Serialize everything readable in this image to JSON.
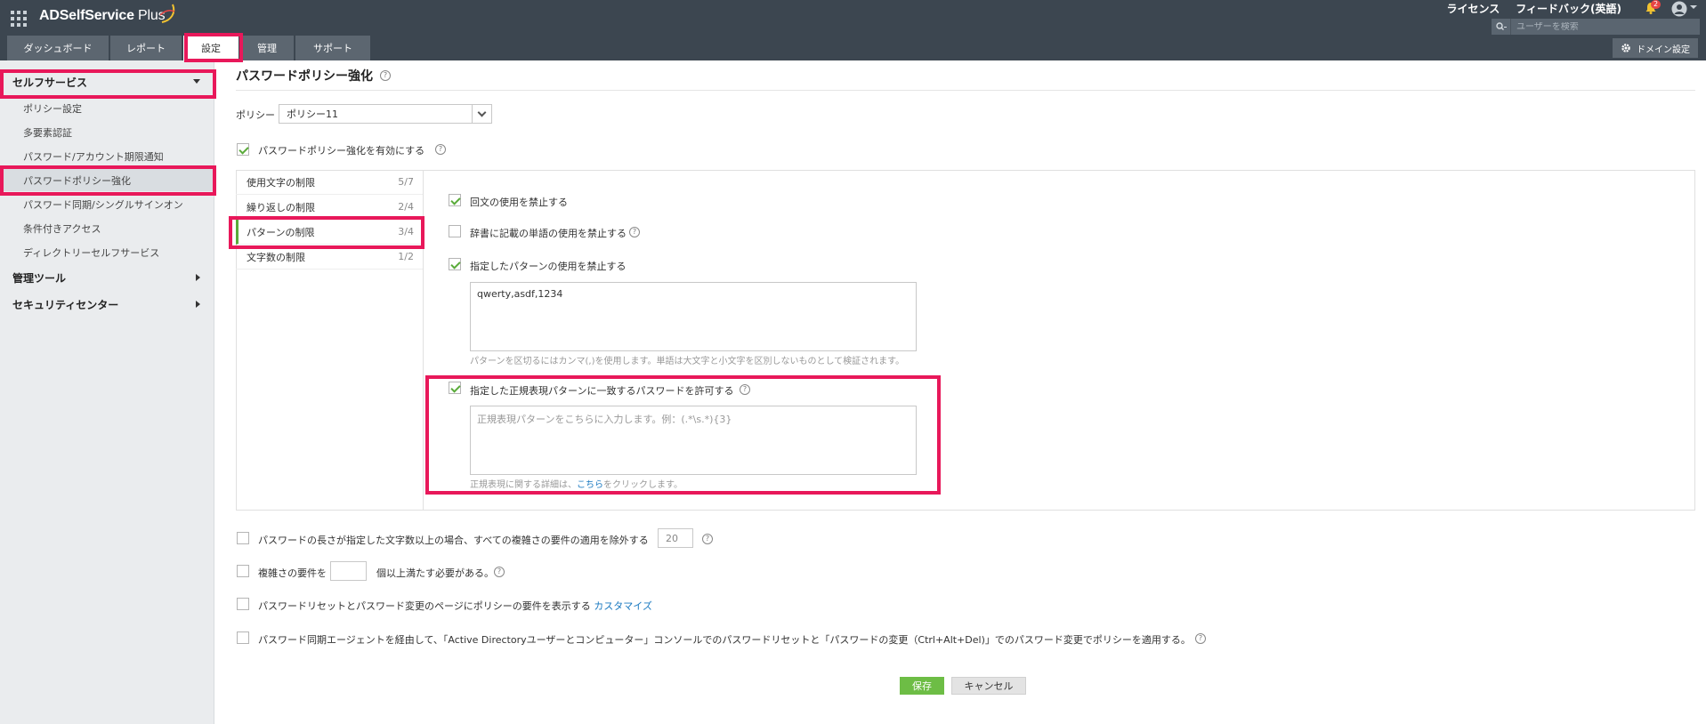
{
  "app": {
    "title": "ADSelfService Plus",
    "title_main": "ADSelfService",
    "title_plus": " Plus"
  },
  "top_links": {
    "license": "ライセンス",
    "feedback": "フィードバック(英語)"
  },
  "notifications": {
    "count": "2"
  },
  "search": {
    "placeholder": "ユーザーを検索"
  },
  "tabs": [
    {
      "label": "ダッシュボード"
    },
    {
      "label": "レポート"
    },
    {
      "label": "設定",
      "active": true
    },
    {
      "label": "管理"
    },
    {
      "label": "サポート"
    }
  ],
  "domain_settings": "ドメイン設定",
  "sidebar": {
    "self_service": "セルフサービス",
    "items": [
      {
        "label": "ポリシー設定"
      },
      {
        "label": "多要素認証"
      },
      {
        "label": "パスワード/アカウント期限通知"
      },
      {
        "label": "パスワードポリシー強化",
        "active": true
      },
      {
        "label": "パスワード同期/シングルサインオン"
      },
      {
        "label": "条件付きアクセス"
      },
      {
        "label": "ディレクトリーセルフサービス"
      }
    ],
    "admin_tools": "管理ツール",
    "security_center": "セキュリティセンター"
  },
  "page": {
    "title": "パスワードポリシー強化",
    "policy_label": "ポリシー",
    "policy_value": "ポリシー11",
    "enable_label": "パスワードポリシー強化を有効にする"
  },
  "rule_nav": [
    {
      "label": "使用文字の制限",
      "count": "5/7"
    },
    {
      "label": "繰り返しの制限",
      "count": "2/4"
    },
    {
      "label": "パターンの制限",
      "count": "3/4",
      "active": true
    },
    {
      "label": "文字数の制限",
      "count": "1/2"
    }
  ],
  "pattern_rules": {
    "palindrome": "回文の使用を禁止する",
    "dictionary": "辞書に記載の単語の使用を禁止する",
    "specified_pattern": "指定したパターンの使用を禁止する",
    "pattern_value": "qwerty,asdf,1234",
    "pattern_hint": "パターンを区切るにはカンマ(,)を使用します。単語は大文字と小文字を区別しないものとして検証されます。",
    "regex_allow": "指定した正規表現パターンに一致するパスワードを許可する",
    "regex_placeholder": "正規表現パターンをこちらに入力します。例：(.*\\s.*){3}",
    "regex_hint_prefix": "正規表現に関する詳細は、",
    "regex_hint_link": "こちら",
    "regex_hint_suffix": "をクリックします。"
  },
  "options": {
    "length_exempt": "パスワードの長さが指定した文字数以上の場合、すべての複雑さの要件の適用を除外する",
    "length_value": "20",
    "complexity_prefix": "複雑さの要件を",
    "complexity_suffix": "個以上満たす必要がある。",
    "show_policy": "パスワードリセットとパスワード変更のページにポリシーの要件を表示する",
    "customize": "カスタマイズ",
    "sync_agent": "パスワード同期エージェントを経由して、「Active Directoryユーザーとコンピューター」コンソールでのパスワードリセットと「パスワードの変更（Ctrl+Alt+Del)」でのパスワード変更でポリシーを適用する。"
  },
  "buttons": {
    "save": "保存",
    "cancel": "キャンセル"
  },
  "colors": {
    "topbar": "#3c4650",
    "highlight": "#e8185a",
    "check": "#5aab3a",
    "save": "#6dbd45",
    "link": "#1a79c0"
  }
}
